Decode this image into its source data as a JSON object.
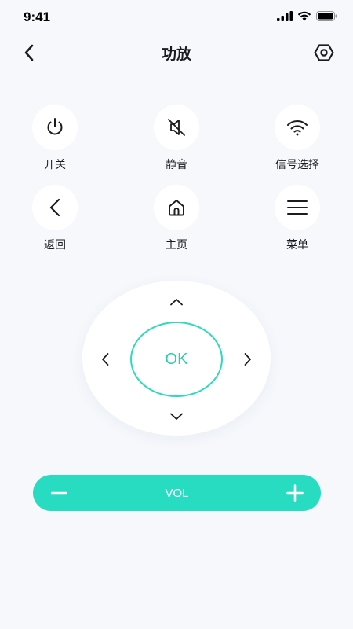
{
  "status_bar": {
    "time": "9:41",
    "icons": [
      "signal-icon",
      "wifi-icon",
      "battery-icon"
    ]
  },
  "nav": {
    "title": "功放",
    "back_icon": "chevron-left-icon",
    "settings_icon": "hexagon-settings-icon"
  },
  "buttons": [
    {
      "label": "开关",
      "icon": "power-icon"
    },
    {
      "label": "静音",
      "icon": "mute-icon"
    },
    {
      "label": "信号选择",
      "icon": "wifi-icon"
    },
    {
      "label": "返回",
      "icon": "chevron-left-icon"
    },
    {
      "label": "主页",
      "icon": "home-icon"
    },
    {
      "label": "菜单",
      "icon": "menu-icon"
    }
  ],
  "dpad": {
    "ok_label": "OK"
  },
  "volume": {
    "label": "VOL"
  },
  "colors": {
    "accent": "#27dcc1",
    "ok_ring": "#2fd9bd",
    "background": "#f6f8fc"
  }
}
